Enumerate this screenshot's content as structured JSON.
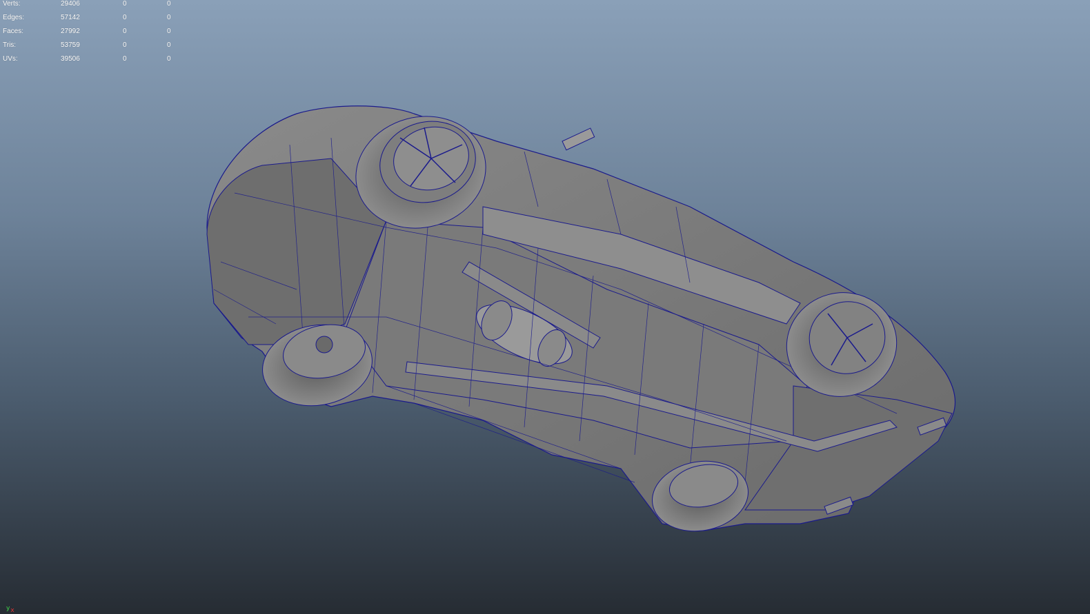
{
  "viewport": {
    "name": "perspective viewport",
    "background_top": "#8aa0b8",
    "background_bottom": "#262c33",
    "wireframe_color": "#1a1a8c",
    "shaded_color": "#7a7a7a"
  },
  "hud": {
    "rows": [
      {
        "label": "Verts:",
        "total": "29406",
        "selected": "0",
        "component": "0"
      },
      {
        "label": "Edges:",
        "total": "57142",
        "selected": "0",
        "component": "0"
      },
      {
        "label": "Faces:",
        "total": "27992",
        "selected": "0",
        "component": "0"
      },
      {
        "label": "Tris:",
        "total": "53759",
        "selected": "0",
        "component": "0"
      },
      {
        "label": "UVs:",
        "total": "39506",
        "selected": "0",
        "component": "0"
      }
    ]
  },
  "axis_gizmo": {
    "y_label": "y",
    "x_label": "x",
    "y_color": "#3fd84a",
    "x_color": "#e03434"
  }
}
